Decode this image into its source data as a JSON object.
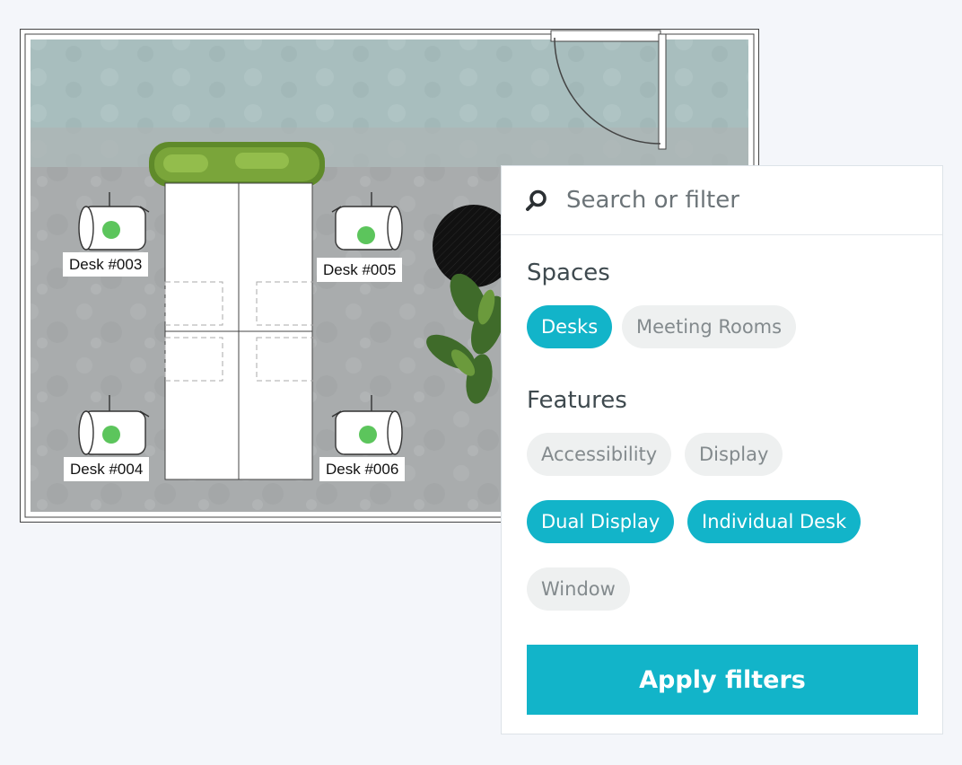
{
  "floorplan": {
    "desks": [
      {
        "label": "Desk #003",
        "status": "available"
      },
      {
        "label": "Desk #005",
        "status": "available"
      },
      {
        "label": "Desk #004",
        "status": "available"
      },
      {
        "label": "Desk #006",
        "status": "available"
      }
    ],
    "colors": {
      "available": "#5cc55c",
      "floor": "#a9acad",
      "glass": "#a8bebe"
    }
  },
  "filter": {
    "search": {
      "placeholder": "Search or filter",
      "value": ""
    },
    "spaces": {
      "heading": "Spaces",
      "options": [
        {
          "label": "Desks",
          "selected": true
        },
        {
          "label": "Meeting Rooms",
          "selected": false
        }
      ]
    },
    "features": {
      "heading": "Features",
      "options": [
        {
          "label": "Accessibility",
          "selected": false
        },
        {
          "label": "Display",
          "selected": false
        },
        {
          "label": "Dual Display",
          "selected": true
        },
        {
          "label": "Individual Desk",
          "selected": true
        },
        {
          "label": "Window",
          "selected": false
        }
      ]
    },
    "apply_label": "Apply filters",
    "colors": {
      "accent": "#12b4c9",
      "chip_off": "#eef0f0"
    }
  }
}
